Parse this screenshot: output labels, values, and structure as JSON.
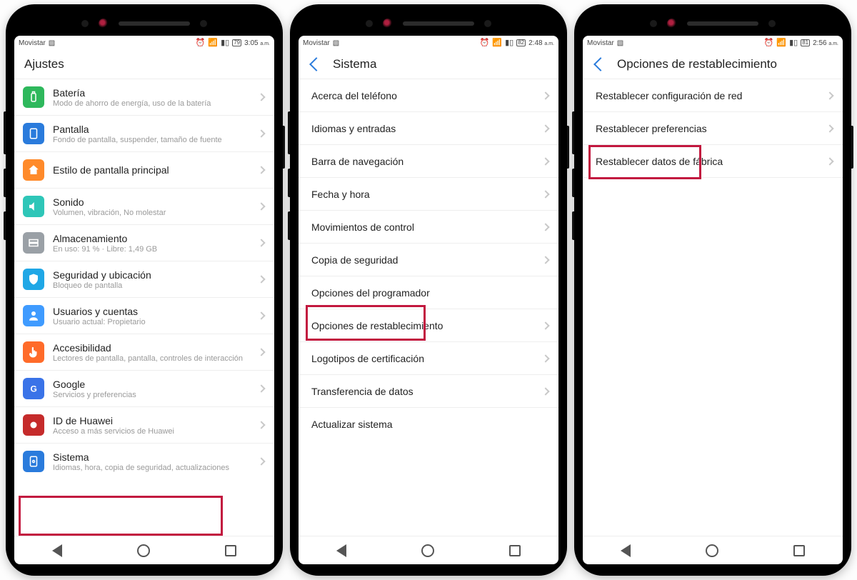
{
  "status": {
    "carrier": "Movistar",
    "batt1": "79",
    "time1": "3:05",
    "batt2": "82",
    "time2": "2:48",
    "batt3": "81",
    "time3": "2:56",
    "ampm": "a.m."
  },
  "phone1": {
    "header": "Ajustes",
    "items": [
      {
        "icon": "battery",
        "color": "c-green",
        "title": "Batería",
        "sub": "Modo de ahorro de energía, uso de la batería"
      },
      {
        "icon": "display",
        "color": "c-blue",
        "title": "Pantalla",
        "sub": "Fondo de pantalla, suspender, tamaño de fuente"
      },
      {
        "icon": "home",
        "color": "c-orange",
        "title": "Estilo de pantalla principal",
        "sub": ""
      },
      {
        "icon": "sound",
        "color": "c-teal",
        "title": "Sonido",
        "sub": "Volumen, vibración, No molestar"
      },
      {
        "icon": "storage",
        "color": "c-gray",
        "title": "Almacenamiento",
        "sub": "En uso: 91 % · Libre: 1,49 GB"
      },
      {
        "icon": "shield",
        "color": "c-cyan",
        "title": "Seguridad y ubicación",
        "sub": "Bloqueo de pantalla"
      },
      {
        "icon": "user",
        "color": "c-lblue",
        "title": "Usuarios y cuentas",
        "sub": "Usuario actual: Propietario"
      },
      {
        "icon": "hand",
        "color": "c-hand",
        "title": "Accesibilidad",
        "sub": "Lectores de pantalla, pantalla, controles de interacción"
      },
      {
        "icon": "google",
        "color": "c-google",
        "title": "Google",
        "sub": "Servicios y preferencias"
      },
      {
        "icon": "huawei",
        "color": "c-huawei",
        "title": "ID de Huawei",
        "sub": "Acceso a más servicios de Huawei"
      },
      {
        "icon": "system",
        "color": "c-blue",
        "title": "Sistema",
        "sub": "Idiomas, hora, copia de seguridad, actualizaciones"
      }
    ],
    "highlight_index": 10
  },
  "phone2": {
    "header": "Sistema",
    "items": [
      {
        "title": "Acerca del teléfono",
        "arrow": true
      },
      {
        "title": "Idiomas y entradas",
        "arrow": true
      },
      {
        "title": "Barra de navegación",
        "arrow": true
      },
      {
        "title": "Fecha y hora",
        "arrow": true
      },
      {
        "title": "Movimientos de control",
        "arrow": true
      },
      {
        "title": "Copia de seguridad",
        "arrow": true
      },
      {
        "title": "Opciones del programador",
        "arrow": false
      },
      {
        "title": "Opciones de restablecimiento",
        "arrow": true
      },
      {
        "title": "Logotipos de certificación",
        "arrow": true
      },
      {
        "title": "Transferencia de datos",
        "arrow": true
      },
      {
        "title": "Actualizar sistema",
        "arrow": false
      }
    ],
    "highlight_index": 7
  },
  "phone3": {
    "header": "Opciones de restablecimiento",
    "items": [
      {
        "title": "Restablecer configuración de red"
      },
      {
        "title": "Restablecer preferencias"
      },
      {
        "title": "Restablecer datos de fábrica"
      }
    ],
    "highlight_index": 2
  }
}
